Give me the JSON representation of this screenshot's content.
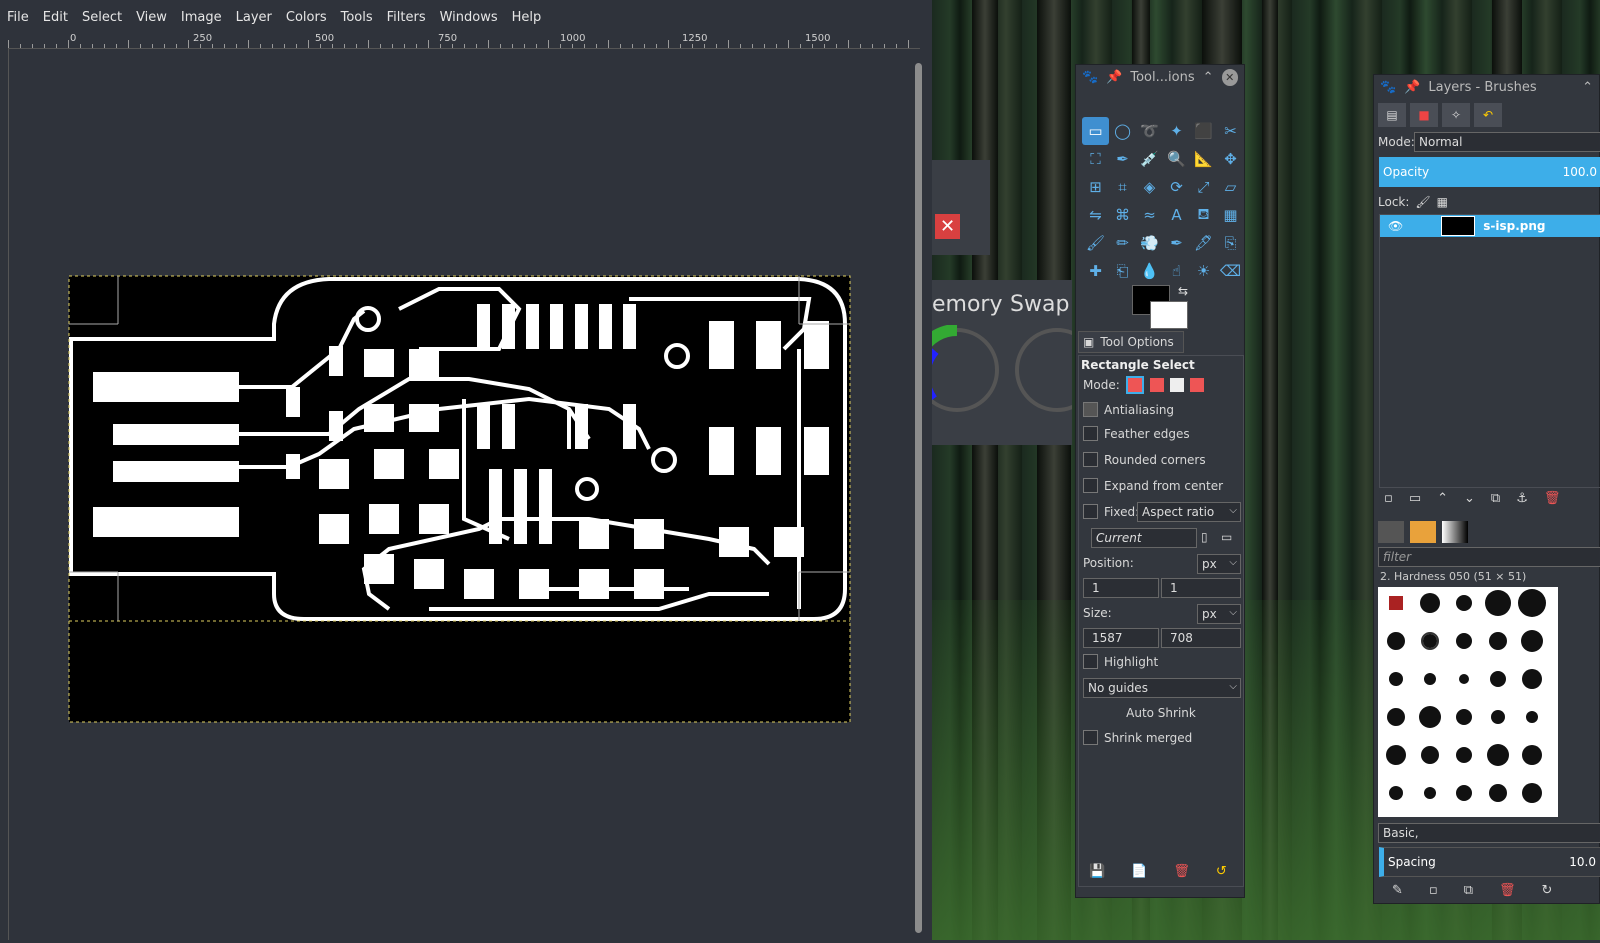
{
  "menu": [
    "File",
    "Edit",
    "Select",
    "View",
    "Image",
    "Layer",
    "Colors",
    "Tools",
    "Filters",
    "Windows",
    "Help"
  ],
  "ruler": {
    "labels": [
      "0",
      "250",
      "500",
      "750",
      "1000",
      "1250",
      "1500"
    ]
  },
  "toolbox": {
    "title": "Tool...ions",
    "tools": [
      "rect-select",
      "ellipse-select",
      "free-select",
      "fuzzy-select",
      "select-by-color",
      "scissors",
      "foreground-select",
      "paths",
      "color-picker",
      "zoom",
      "measure",
      "move",
      "align",
      "crop",
      "unified-transform",
      "rotate",
      "scale",
      "shear",
      "flip",
      "cage",
      "warp",
      "text",
      "bucket-fill",
      "gradient",
      "paintbrush",
      "pencil",
      "airbrush",
      "ink",
      "mypaint",
      "clone",
      "heal",
      "perspective-clone",
      "blur",
      "smudge",
      "dodge",
      "eraser"
    ]
  },
  "tool_options": {
    "tab_label": "Tool Options",
    "tool_name": "Rectangle Select",
    "mode_label": "Mode:",
    "antialiasing": "Antialiasing",
    "feather": "Feather edges",
    "rounded": "Rounded corners",
    "expand": "Expand from center",
    "fixed_label": "Fixed:",
    "fixed_value": "Aspect ratio",
    "current": "Current",
    "position_label": "Position:",
    "pos_unit": "px",
    "pos_x": "1",
    "pos_y": "1",
    "size_label": "Size:",
    "size_unit": "px",
    "size_w": "1587",
    "size_h": "708",
    "highlight": "Highlight",
    "guides": "No guides",
    "auto_shrink": "Auto Shrink",
    "shrink_merged": "Shrink merged"
  },
  "layers": {
    "title": "Layers - Brushes",
    "mode_label": "Mode:",
    "mode_value": "Normal",
    "opacity_label": "Opacity",
    "opacity_value": "100.0",
    "lock_label": "Lock:",
    "layer_name": "s-isp.png"
  },
  "brushes": {
    "filter_placeholder": "filter",
    "selected": "2. Hardness 050 (51 × 51)",
    "preset": "Basic,",
    "spacing_label": "Spacing",
    "spacing_value": "10.0"
  },
  "background_panel": {
    "memory": "emory",
    "swap": "Swap"
  }
}
